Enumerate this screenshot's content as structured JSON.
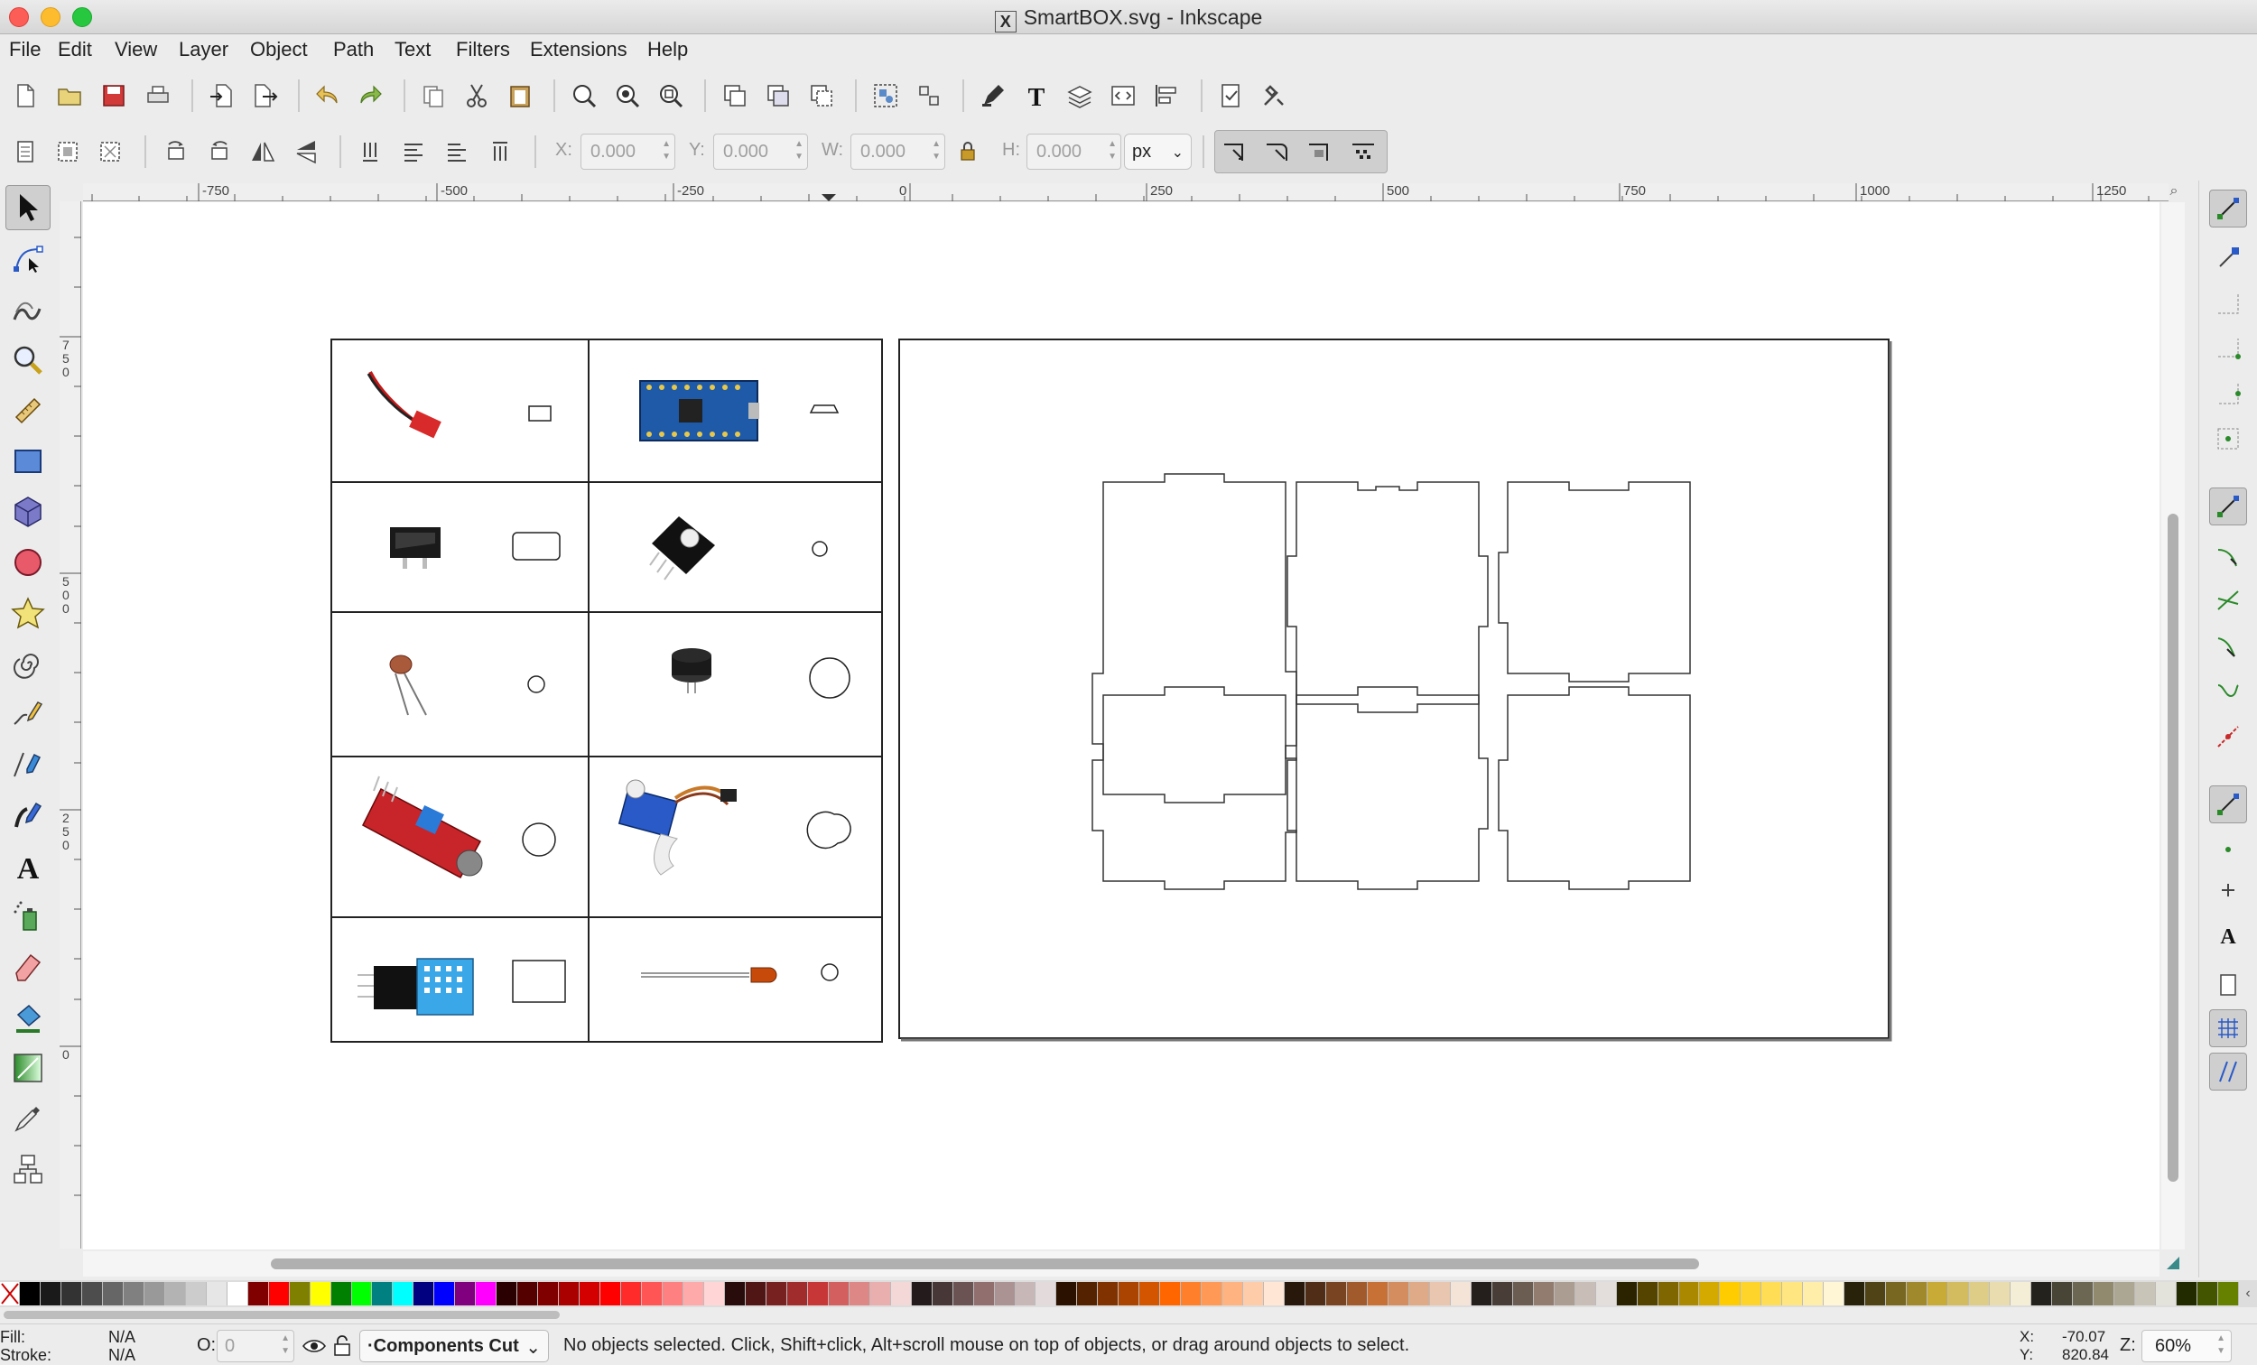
{
  "window": {
    "title": "SmartBOX.svg - Inkscape"
  },
  "menu": [
    "File",
    "Edit",
    "View",
    "Layer",
    "Object",
    "Path",
    "Text",
    "Filters",
    "Extensions",
    "Help"
  ],
  "controls": {
    "x_label": "X:",
    "x_value": "0.000",
    "y_label": "Y:",
    "y_value": "0.000",
    "w_label": "W:",
    "w_value": "0.000",
    "h_label": "H:",
    "h_value": "0.000",
    "unit": "px"
  },
  "rulers": {
    "top": [
      "-750",
      "-500",
      "-250",
      "0",
      "250",
      "500",
      "750",
      "1000",
      "1250"
    ],
    "left": [
      "750",
      "500",
      "250",
      "0"
    ]
  },
  "status": {
    "fill_label": "Fill:",
    "fill_value": "N/A",
    "stroke_label": "Stroke:",
    "stroke_value": "N/A",
    "opacity_label": "O:",
    "opacity_value": "0",
    "layer": "·Components Cut",
    "message": "No objects selected. Click, Shift+click, Alt+scroll mouse on top of objects, or drag around objects to select.",
    "coord_x_label": "X:",
    "coord_x": "-70.07",
    "coord_y_label": "Y:",
    "coord_y": "820.84",
    "zoom_label": "Z:",
    "zoom": "60%"
  },
  "palette_colors": [
    "#000000",
    "#1a1a1a",
    "#333333",
    "#4d4d4d",
    "#666666",
    "#808080",
    "#999999",
    "#b3b3b3",
    "#cccccc",
    "#e6e6e6",
    "#ffffff",
    "#800000",
    "#ff0000",
    "#808000",
    "#ffff00",
    "#008000",
    "#00ff00",
    "#008080",
    "#00ffff",
    "#000080",
    "#0000ff",
    "#800080",
    "#ff00ff",
    "#2b0000",
    "#550000",
    "#800000",
    "#aa0000",
    "#d40000",
    "#ff0000",
    "#ff2a2a",
    "#ff5555",
    "#ff8080",
    "#ffaaaa",
    "#ffd5d5",
    "#280b0b",
    "#501616",
    "#782121",
    "#a02c2c",
    "#c83737",
    "#d35f5f",
    "#de8787",
    "#e9afaf",
    "#f4d7d7",
    "#241c1c",
    "#483737",
    "#6c5353",
    "#916f6f",
    "#ac9393",
    "#c8b7b7",
    "#e3dbdb",
    "#2b1100",
    "#552200",
    "#803300",
    "#aa4400",
    "#d45500",
    "#ff6600",
    "#ff7f2a",
    "#ff9955",
    "#ffb380",
    "#ffccaa",
    "#ffe6d5",
    "#28170b",
    "#502d16",
    "#784421",
    "#a05a2c",
    "#c87137",
    "#d38d5f",
    "#deaa87",
    "#e9c6af",
    "#f4e3d7",
    "#241f1c",
    "#483e37",
    "#6c5d53",
    "#917c6f",
    "#ac9d93",
    "#c8beb7",
    "#e3dedb",
    "#2b2200",
    "#554400",
    "#806600",
    "#aa8800",
    "#d4aa00",
    "#ffcc00",
    "#ffd42a",
    "#ffdd55",
    "#ffe680",
    "#ffeeaa",
    "#fff6d5",
    "#28220b",
    "#504416",
    "#786721",
    "#a0892c",
    "#c8ab37",
    "#d3bc5f",
    "#decd87",
    "#e9ddaf",
    "#f4eed7",
    "#24221c",
    "#484537",
    "#6c6753",
    "#918a6f",
    "#aca793",
    "#c8c4b7",
    "#e3e2db",
    "#222b00",
    "#445500",
    "#668000"
  ]
}
